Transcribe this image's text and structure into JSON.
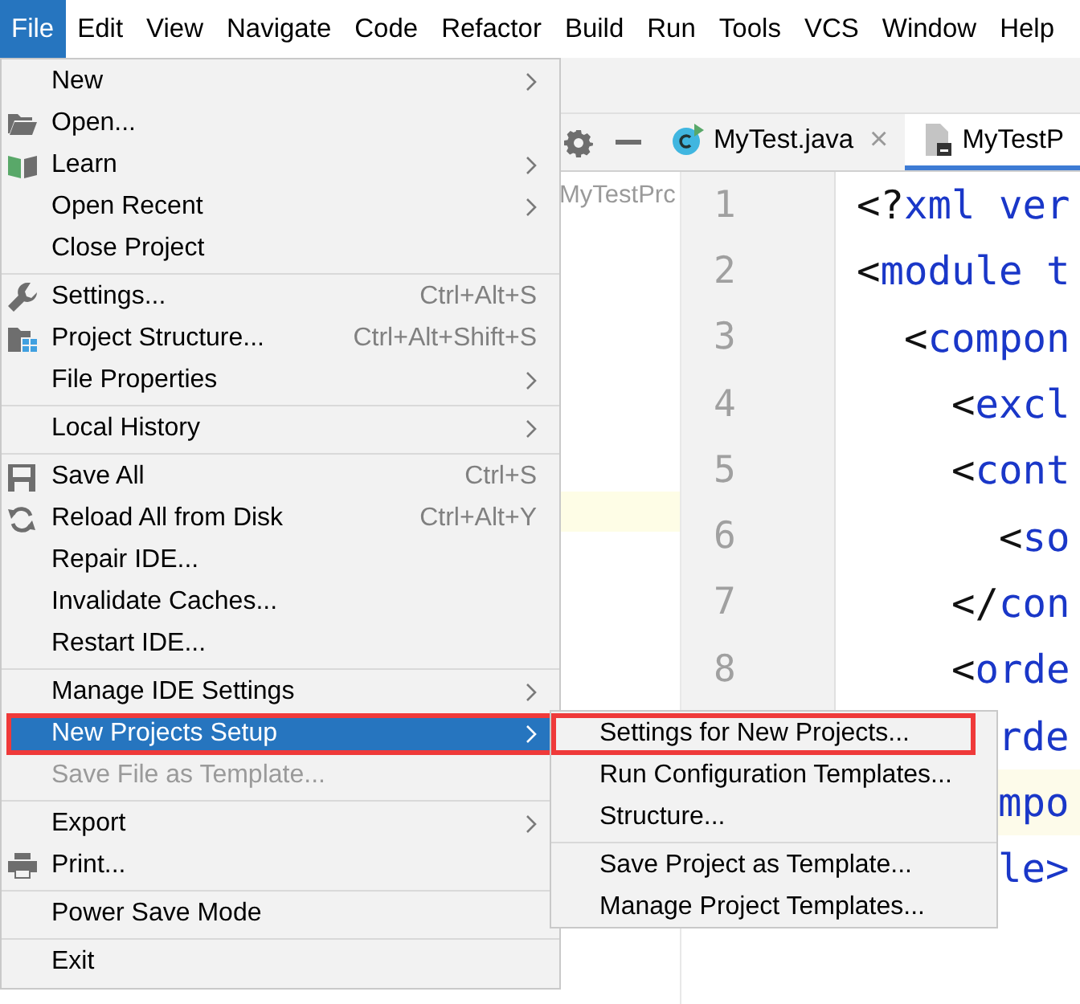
{
  "menubar": [
    {
      "label": "File",
      "selected": true
    },
    {
      "label": "Edit",
      "selected": false
    },
    {
      "label": "View",
      "selected": false
    },
    {
      "label": "Navigate",
      "selected": false
    },
    {
      "label": "Code",
      "selected": false
    },
    {
      "label": "Refactor",
      "selected": false
    },
    {
      "label": "Build",
      "selected": false
    },
    {
      "label": "Run",
      "selected": false
    },
    {
      "label": "Tools",
      "selected": false
    },
    {
      "label": "VCS",
      "selected": false
    },
    {
      "label": "Window",
      "selected": false
    },
    {
      "label": "Help",
      "selected": false
    }
  ],
  "file_menu": {
    "sections": [
      [
        {
          "label": "New",
          "submenu": true,
          "selected": false,
          "disabled": false
        },
        {
          "label": "Open...",
          "selected": false,
          "disabled": false
        },
        {
          "label": "Learn",
          "submenu": true,
          "selected": false,
          "disabled": false
        },
        {
          "label": "Open Recent",
          "submenu": true,
          "selected": false,
          "disabled": false
        },
        {
          "label": "Close Project",
          "selected": false,
          "disabled": false
        }
      ],
      [
        {
          "label": "Settings...",
          "shortcut": "Ctrl+Alt+S",
          "selected": false,
          "disabled": false
        },
        {
          "label": "Project Structure...",
          "shortcut": "Ctrl+Alt+Shift+S",
          "selected": false,
          "disabled": false
        },
        {
          "label": "File Properties",
          "submenu": true,
          "selected": false,
          "disabled": false
        }
      ],
      [
        {
          "label": "Local History",
          "submenu": true,
          "selected": false,
          "disabled": false
        }
      ],
      [
        {
          "label": "Save All",
          "shortcut": "Ctrl+S",
          "selected": false,
          "disabled": false
        },
        {
          "label": "Reload All from Disk",
          "shortcut": "Ctrl+Alt+Y",
          "selected": false,
          "disabled": false
        },
        {
          "label": "Repair IDE...",
          "selected": false,
          "disabled": false
        },
        {
          "label": "Invalidate Caches...",
          "selected": false,
          "disabled": false
        },
        {
          "label": "Restart IDE...",
          "selected": false,
          "disabled": false
        }
      ],
      [
        {
          "label": "Manage IDE Settings",
          "submenu": true,
          "selected": false,
          "disabled": false
        },
        {
          "label": "New Projects Setup",
          "submenu": true,
          "selected": true,
          "disabled": false,
          "outlined": true
        },
        {
          "label": "Save File as Template...",
          "selected": false,
          "disabled": true
        }
      ],
      [
        {
          "label": "Export",
          "submenu": true,
          "selected": false,
          "disabled": false
        },
        {
          "label": "Print...",
          "selected": false,
          "disabled": false
        }
      ],
      [
        {
          "label": "Power Save Mode",
          "selected": false,
          "disabled": false
        }
      ],
      [
        {
          "label": "Exit",
          "selected": false,
          "disabled": false
        }
      ]
    ]
  },
  "submenu": {
    "sections": [
      [
        {
          "label": "Settings for New Projects...",
          "outlined": true
        },
        {
          "label": "Run Configuration Templates..."
        },
        {
          "label": "Structure..."
        }
      ],
      [
        {
          "label": "Save Project as Template..."
        },
        {
          "label": "Manage Project Templates..."
        }
      ]
    ]
  },
  "project_panel": {
    "title": "MyTestPrc"
  },
  "tabs": [
    {
      "label": "MyTest.java",
      "close": "×",
      "selected": false
    },
    {
      "label": "MyTestP",
      "selected": true
    }
  ],
  "editor": {
    "lines": [
      {
        "number": "1",
        "text": "<?xml ver",
        "kind": "full",
        "current": false
      },
      {
        "number": "2",
        "text": "<module t",
        "kind": "full",
        "current": false
      },
      {
        "number": "3",
        "text": "  <compon",
        "kind": "full",
        "current": false
      },
      {
        "number": "4",
        "text": "    <excl",
        "kind": "full",
        "current": false
      },
      {
        "number": "5",
        "text": "    <cont",
        "kind": "full",
        "current": false
      },
      {
        "number": "6",
        "text": "      <so",
        "kind": "full",
        "current": false
      },
      {
        "number": "7",
        "text": "    </con",
        "kind": "full",
        "current": false
      },
      {
        "number": "8",
        "text": "    <orde",
        "kind": "full",
        "current": false
      },
      {
        "text": "rde",
        "kind": "clipped",
        "current": false
      },
      {
        "text": "mpo",
        "kind": "clipped",
        "current": true
      },
      {
        "text": "le>",
        "kind": "clipped",
        "current": false
      }
    ]
  }
}
